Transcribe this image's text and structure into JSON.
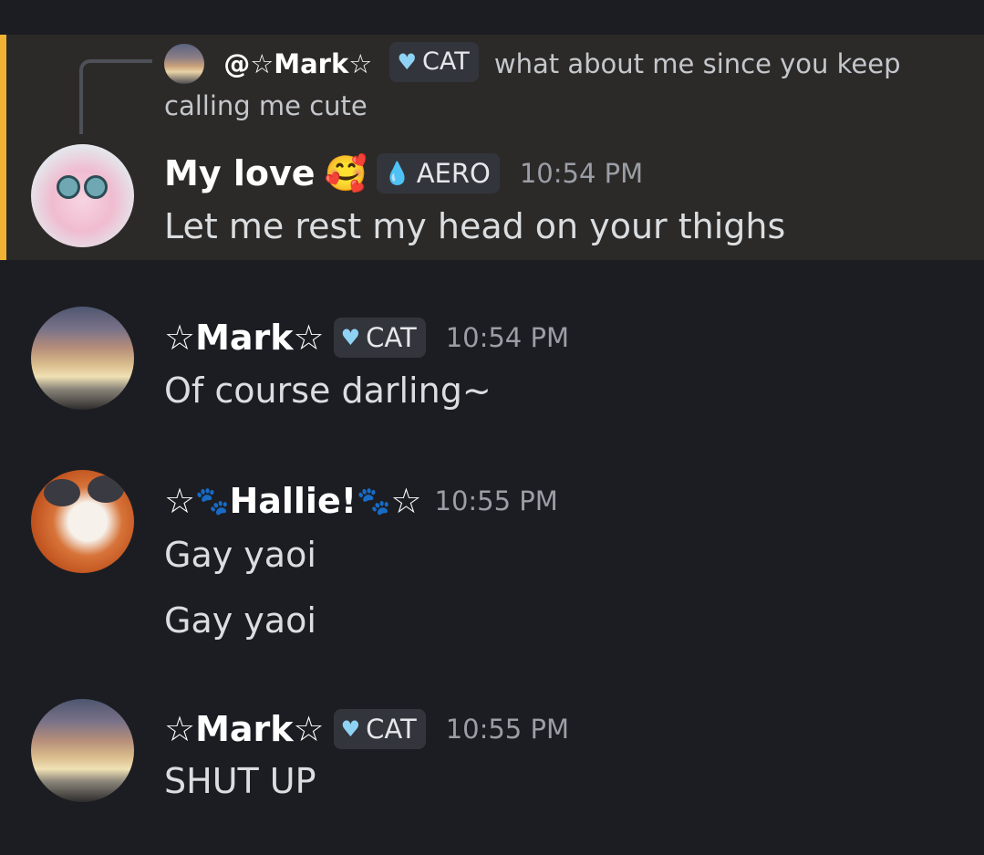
{
  "reply": {
    "author": "@☆Mark☆",
    "tag": "CAT",
    "tag_icon": "heart-icon",
    "text": "what about me since you keep calling me cute"
  },
  "messages": [
    {
      "author": "My love",
      "author_emoji": "🥰",
      "tag": "AERO",
      "tag_icon": "water-drop-icon",
      "time": "10:54 PM",
      "lines": [
        "Let me rest my head on your thighs"
      ]
    },
    {
      "author": "☆Mark☆",
      "tag": "CAT",
      "tag_icon": "heart-icon",
      "time": "10:54 PM",
      "lines": [
        "Of course darling~"
      ]
    },
    {
      "author_prefix": "☆",
      "author_paw_left": "🐾",
      "author": "Hallie!",
      "author_paw_right": "🐾",
      "author_suffix": "☆",
      "time": "10:55 PM",
      "lines": [
        "Gay yaoi",
        "Gay yaoi"
      ]
    },
    {
      "author": "☆Mark☆",
      "tag": "CAT",
      "tag_icon": "heart-icon",
      "time": "10:55 PM",
      "lines": [
        "SHUT UP"
      ]
    }
  ],
  "colors": {
    "background": "#1c1d22",
    "highlight": "#2c2a28",
    "highlight_bar": "#f0b232",
    "timestamp": "#9b9ea6",
    "tag_background": "#33353c"
  }
}
